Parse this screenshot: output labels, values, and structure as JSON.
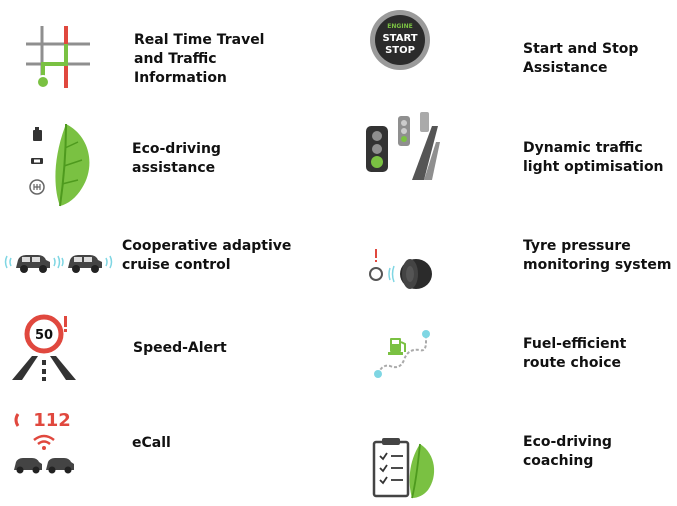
{
  "colors": {
    "green": "#7ac142",
    "green_dark": "#4e9a1e",
    "red": "#e0483e",
    "gray": "#8f8f8f",
    "dark": "#333333",
    "cyan": "#7fd6e3"
  },
  "features": {
    "real_time_traffic": {
      "lines": [
        "Real Time Travel",
        "and Traffic",
        "Information"
      ],
      "icon": "map-crossroads-icon"
    },
    "start_stop": {
      "lines": [
        "Start and Stop",
        "Assistance"
      ],
      "icon": "start-stop-button-icon",
      "button_top": "ENGINE",
      "button_line1": "START",
      "button_line2": "STOP"
    },
    "eco_driving_assistance": {
      "lines": [
        "Eco-driving",
        "assistance"
      ],
      "icon": "eco-leaf-icon"
    },
    "dynamic_traffic_light": {
      "lines": [
        "Dynamic traffic",
        "light optimisation"
      ],
      "icon": "traffic-light-icon"
    },
    "cooperative_cruise": {
      "lines": [
        "Cooperative adaptive",
        "cruise control"
      ],
      "icon": "connected-cars-icon"
    },
    "tyre_pressure": {
      "lines": [
        "Tyre pressure",
        "monitoring system"
      ],
      "icon": "tyre-icon"
    },
    "speed_alert": {
      "lines": [
        "Speed-Alert"
      ],
      "icon": "speed-sign-icon",
      "sign_value": "50"
    },
    "fuel_efficient_route": {
      "lines": [
        "Fuel-efficient",
        "route choice"
      ],
      "icon": "route-fuel-icon"
    },
    "ecall": {
      "lines": [
        "eCall"
      ],
      "icon": "emergency-call-icon",
      "number": "112"
    },
    "eco_driving_coaching": {
      "lines": [
        "Eco-driving",
        "coaching"
      ],
      "icon": "checklist-leaf-icon"
    }
  }
}
